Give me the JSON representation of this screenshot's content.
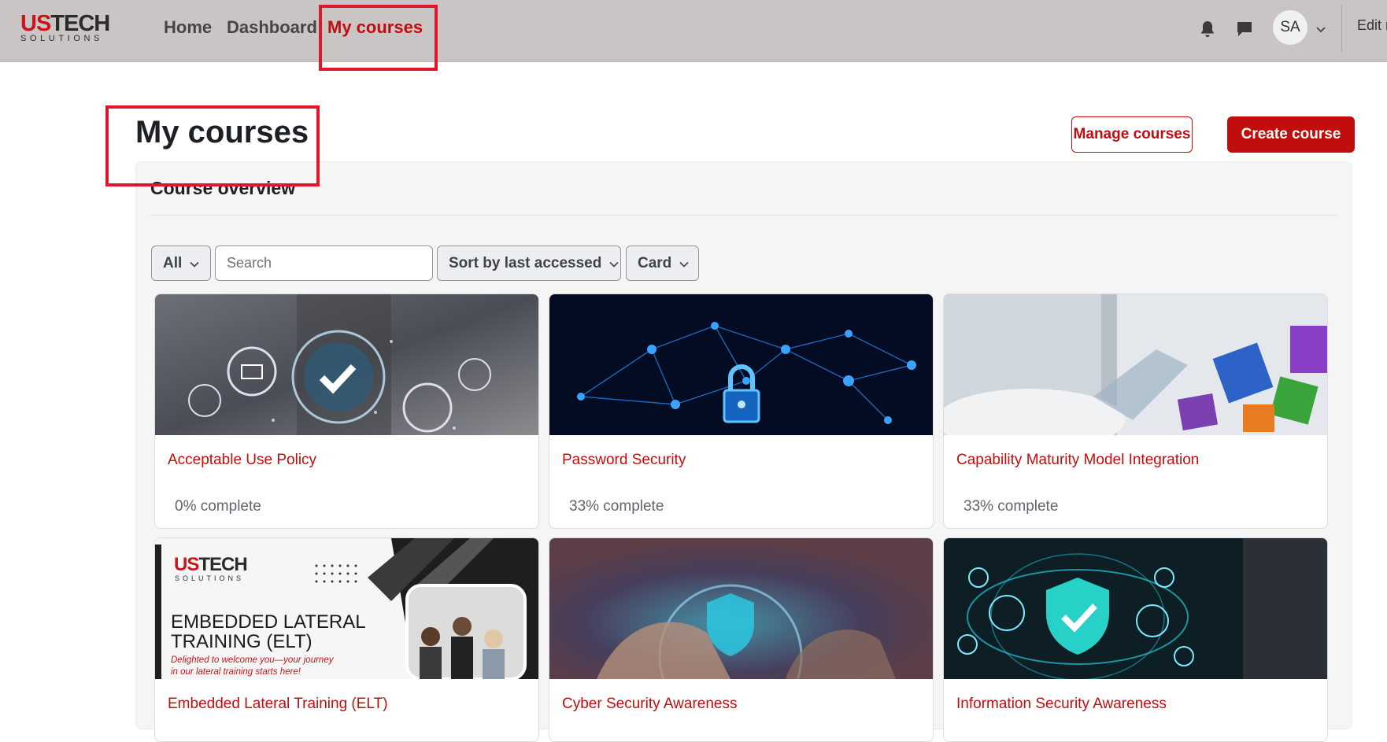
{
  "brand": {
    "logo_top": "USTECH",
    "logo_top_red": "US",
    "logo_top_dark": "TECH",
    "logo_bottom": "SOLUTIONS"
  },
  "nav": {
    "home": "Home",
    "dashboard": "Dashboard",
    "my_courses": "My courses",
    "avatar_initials": "SA",
    "edit_mode": "Edit m",
    "icons": [
      "bell-icon",
      "chat-icon",
      "chevron-down-icon"
    ]
  },
  "page": {
    "title": "My courses",
    "manage_button": "Manage courses",
    "create_button": "Create course"
  },
  "overview": {
    "title": "Course overview",
    "filter_label": "All",
    "search_placeholder": "Search",
    "sort_label": "Sort by last accessed",
    "view_label": "Card"
  },
  "courses": [
    {
      "title": "Acceptable Use Policy",
      "progress": "0% complete",
      "progress_value": 0
    },
    {
      "title": "Password Security",
      "progress": "33% complete",
      "progress_value": 33
    },
    {
      "title": "Capability Maturity Model Integration",
      "progress": "33% complete",
      "progress_value": 33
    },
    {
      "title": "Embedded Lateral Training (ELT)",
      "progress": "",
      "progress_value": null
    },
    {
      "title": "Cyber Security Awareness",
      "progress": "",
      "progress_value": null
    },
    {
      "title": "Information Security Awareness",
      "progress": "",
      "progress_value": null
    }
  ],
  "elt_banner": {
    "logo_top": "USTECH",
    "logo_bottom": "SOLUTIONS",
    "heading_line1": "EMBEDDED LATERAL",
    "heading_line2": "TRAINING (ELT)",
    "tagline_line1": "Delighted to welcome you—your journey",
    "tagline_line2": "in our lateral training starts here!"
  },
  "colors": {
    "accent": "#c00d0d",
    "navbar": "#c9c5c4",
    "highlight_box": "#e0162b",
    "panel": "#f5f5f5"
  }
}
